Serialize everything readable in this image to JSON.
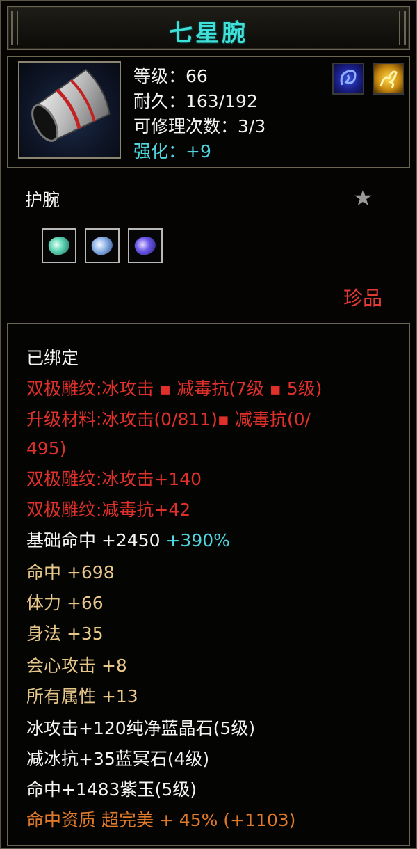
{
  "item": {
    "name": "七星腕",
    "level_line": "等级：66",
    "durability_line": "耐久：163/192",
    "repair_line": "可修理次数：3/3",
    "enhance_line": "强化：+9",
    "category": "护腕",
    "rarity": "珍品",
    "icon": "wrist-guard-icon",
    "badges": [
      "blue-spirit-badge-icon",
      "gold-spirit-badge-icon"
    ],
    "gem_slots": [
      "green-gem-icon",
      "blue-gem-icon",
      "purple-gem-icon"
    ]
  },
  "attributes": {
    "bound": "已绑定",
    "engrave_combo": "双极雕纹:冰攻击 ▪ 减毒抗(7级 ▪ 5级)",
    "upgrade_material_1": "升级材料:冰攻击(0/811)▪ 减毒抗(0/",
    "upgrade_material_2": "495)",
    "engrave_ice": "双极雕纹:冰攻击+140",
    "engrave_poison": "双极雕纹:减毒抗+42",
    "base_hit_label": "基础命中  +2450",
    "base_hit_pct": "+390%",
    "hit": "命中  +698",
    "stamina": "体力  +66",
    "agility": "身法  +35",
    "crit": "会心攻击  +8",
    "all_attr": "所有属性  +13",
    "gem_ice": "冰攻击+120纯净蓝晶石(5级)",
    "gem_ice_resist": "减冰抗+35蓝冥石(4级)",
    "gem_hit": "命中+1483紫玉(5级)",
    "quality": "命中资质  超完美  +  45%  (+1103)"
  },
  "colors": {
    "title": "#3fe0d8",
    "red": "#e0302a",
    "gold": "#e8c88a",
    "cyan": "#4fd6e0",
    "orange": "#e07a2a"
  }
}
